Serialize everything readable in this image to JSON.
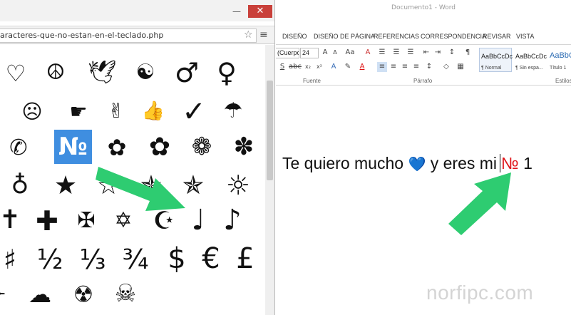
{
  "browser": {
    "url": "aracteres-que-no-estan-en-el-teclado.php",
    "minimize_label": "—",
    "maximize_label": "□",
    "close_label": "✕",
    "symbols": [
      [
        "♡",
        "☮",
        "🕊",
        "☯",
        "♂",
        "♀"
      ],
      [
        "☹",
        "☛",
        "✌",
        "👍",
        "✓",
        "☂"
      ],
      [
        "✆",
        "№",
        "✿",
        "✿",
        "❁",
        "✽"
      ],
      [
        "♁",
        "★",
        "☆",
        "✯",
        "✯",
        "☼"
      ],
      [
        "✝",
        "✚",
        "✠",
        "✡",
        "☪",
        "♩",
        "♪"
      ],
      [
        "♯",
        "½",
        "⅓",
        "¾",
        "$",
        "€",
        "£"
      ],
      [
        "✈",
        "☁",
        "☢",
        "☠"
      ]
    ]
  },
  "word": {
    "title": "Documento1 - Word",
    "tabs": [
      "DISEÑO",
      "DISEÑO DE PÁGINA",
      "REFERENCIAS",
      "CORRESPONDENCIA",
      "REVISAR",
      "VISTA"
    ],
    "font_name": "(Cuerpo",
    "font_size": "24",
    "styles": [
      {
        "preview": "AaBbCcDc",
        "name": "¶ Normal"
      },
      {
        "preview": "AaBbCcDc",
        "name": "¶ Sin espa..."
      },
      {
        "preview": "AaBbC",
        "name": "Título 1"
      }
    ],
    "groups": {
      "font": "Fuente",
      "paragraph": "Párrafo",
      "styles": "Estilos"
    },
    "document_text": {
      "before": "Te quiero mucho",
      "heart": "💙",
      "middle": "y eres mi",
      "symbol": "№",
      "after": "1"
    }
  },
  "watermark": "norfipc.com",
  "colors": {
    "selection": "#3f8ee0",
    "arrow": "#2ecc71",
    "numero": "#e0161b",
    "close_button": "#c9403a"
  }
}
